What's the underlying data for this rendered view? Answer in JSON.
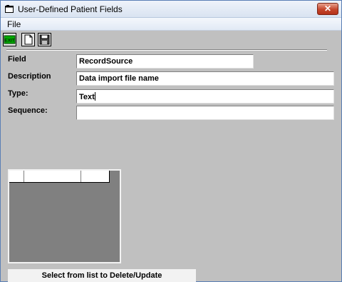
{
  "window": {
    "title": "User-Defined Patient Fields",
    "close_label": "✕"
  },
  "menu": {
    "items": [
      "File"
    ]
  },
  "toolbar": {
    "buttons": [
      {
        "name": "exit",
        "label": "EXIT",
        "icon": "exit-icon",
        "color": "#00aa00"
      },
      {
        "name": "new",
        "icon": "new-document-icon"
      },
      {
        "name": "save",
        "icon": "floppy-disk-icon"
      }
    ]
  },
  "form": {
    "field": {
      "label": "Field",
      "value": "RecordSource"
    },
    "description": {
      "label": "Description",
      "value": "Data import file name"
    },
    "type": {
      "label": "Type:",
      "value": "Text"
    },
    "sequence": {
      "label": "Sequence:",
      "value": ""
    }
  },
  "list": {
    "status_text": "Select from list to Delete/Update"
  },
  "colors": {
    "window_bg": "#c0c0c0",
    "grid_bg": "#808080",
    "close_button": "#c4452b"
  }
}
